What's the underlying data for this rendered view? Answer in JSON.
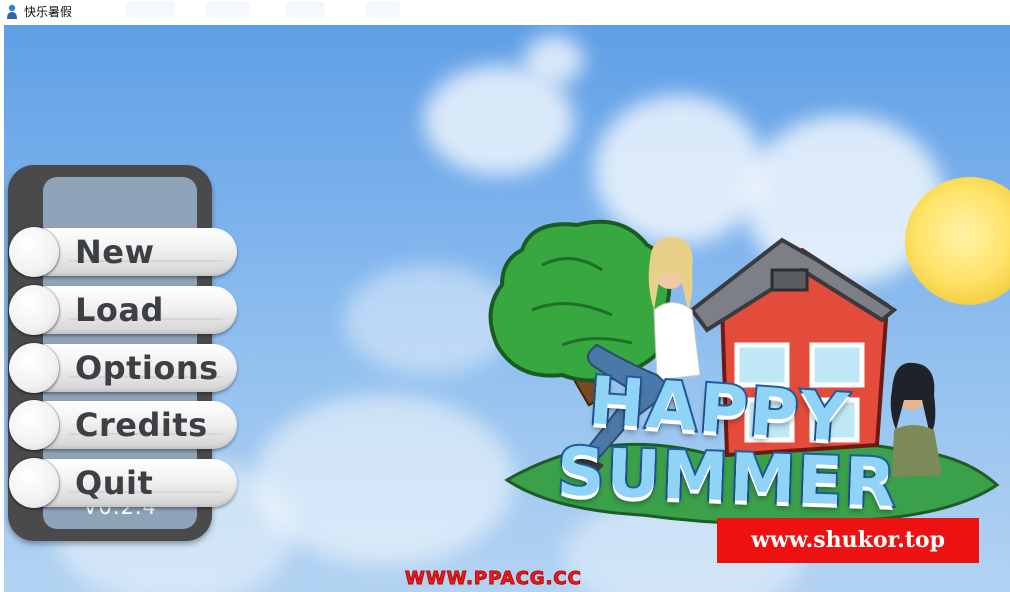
{
  "window": {
    "title": "快乐暑假",
    "icon": "game-app-icon"
  },
  "menu": {
    "items": [
      {
        "label": "New"
      },
      {
        "label": "Load"
      },
      {
        "label": "Options"
      },
      {
        "label": "Credits"
      },
      {
        "label": "Quit"
      }
    ],
    "version": "V0.2.4"
  },
  "logo": {
    "line1": "Happy",
    "line2": "Summer"
  },
  "watermarks": {
    "site": "www.shukor.top",
    "footer": "WWW.PPACG.CC"
  },
  "colors": {
    "sky_top": "#5f9fe6",
    "menu_frame": "#4a4a4c",
    "menu_inner": "#8ea2b8",
    "logo_fill": "#8fd3f6",
    "logo_outline": "#1f5b9e",
    "watermark_bg": "#ee1111"
  }
}
